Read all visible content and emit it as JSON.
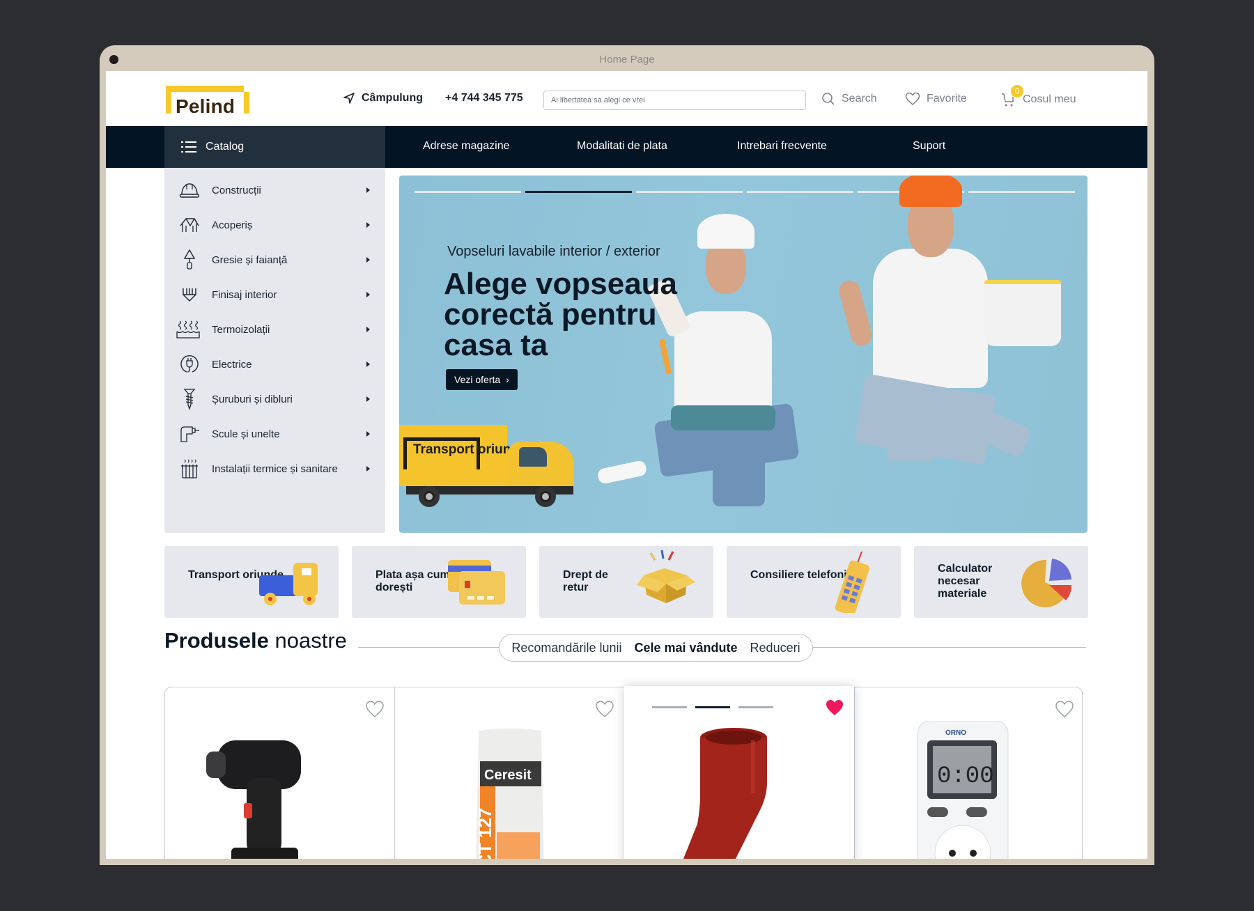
{
  "window": {
    "title": "Home Page"
  },
  "header": {
    "logo_text": "Pelind",
    "location": "Câmpulung",
    "phone": "+4 744 345 775",
    "search_placeholder": "Ai libertatea sa alegi ce vrei",
    "search_label": "Search",
    "favorites_label": "Favorite",
    "cart_label": "Cosul meu",
    "cart_count": "0"
  },
  "nav": {
    "catalog_label": "Catalog",
    "items": [
      {
        "label": "Adrese magazine"
      },
      {
        "label": "Modalitati de plata"
      },
      {
        "label": "Intrebari frecvente"
      },
      {
        "label": "Suport"
      }
    ]
  },
  "catalog": {
    "items": [
      {
        "label": "Construcții",
        "icon": "hard-hat-icon"
      },
      {
        "label": "Acoperiș",
        "icon": "roof-icon"
      },
      {
        "label": "Gresie și faianță",
        "icon": "trowel-icon"
      },
      {
        "label": "Finisaj interior",
        "icon": "brush-icon"
      },
      {
        "label": "Termoizolații",
        "icon": "heat-insulation-icon"
      },
      {
        "label": "Electrice",
        "icon": "plug-icon"
      },
      {
        "label": "Șuruburi și dibluri",
        "icon": "screw-icon"
      },
      {
        "label": "Scule și unelte",
        "icon": "drill-icon"
      },
      {
        "label": "Instalații termice și sanitare",
        "icon": "radiator-icon"
      }
    ]
  },
  "hero": {
    "subtitle": "Vopseluri lavabile interior / exterior",
    "title": "Alege vopseaua corectă pentru casa ta",
    "button_label": "Vezi oferta",
    "slides_total": 6,
    "active_slide": 2,
    "truck_text": "Transport oriunde",
    "colors": {
      "background": "#8fc2d6",
      "truck": "#f5c42d"
    }
  },
  "features": [
    {
      "label": "Transport oriunde",
      "icon": "toy-truck-icon"
    },
    {
      "label": "Plata așa cum dorești",
      "icon": "credit-cards-icon"
    },
    {
      "label": "Drept de retur",
      "icon": "open-box-icon"
    },
    {
      "label": "Consiliere telefonică",
      "icon": "mobile-phone-icon"
    },
    {
      "label": "Calculator necesar materiale",
      "icon": "pie-chart-icon"
    }
  ],
  "products": {
    "heading_bold": "Produsele",
    "heading_light": "noastre",
    "tabs": [
      {
        "label": "Recomandările lunii",
        "active": false
      },
      {
        "label": "Cele mai vândute",
        "active": true
      },
      {
        "label": "Reduceri",
        "active": false
      }
    ],
    "items": [
      {
        "name": "Cordless drill",
        "favorite": false,
        "image": "drill-image"
      },
      {
        "name": "Ceresit CT 127",
        "favorite": false,
        "image": "ceresit-bag-image"
      },
      {
        "name": "Red gutter elbow",
        "favorite": true,
        "image": "gutter-elbow-image",
        "gallery_total": 3,
        "gallery_active": 2
      },
      {
        "name": "ORNO energy meter socket",
        "favorite": false,
        "image": "energy-meter-image"
      }
    ],
    "colors": {
      "favorite_active": "#f0185a",
      "favorite_inactive": "#9aa0a6"
    }
  }
}
